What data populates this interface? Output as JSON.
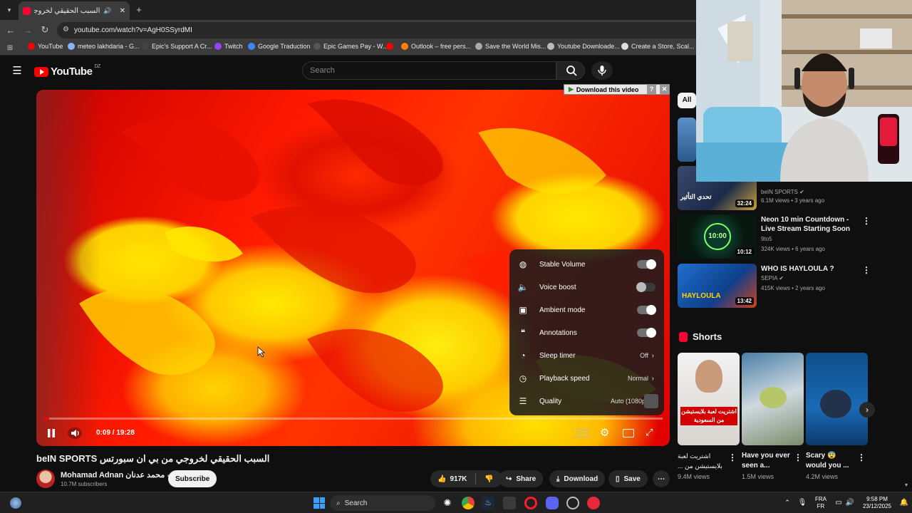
{
  "browser": {
    "tab_title": "السبب الحقيقي لخروجي من بي ...",
    "url": "youtube.com/watch?v=AgH0SSyrdMI",
    "bookmarks": [
      "YouTube",
      "meteo lakhdaria - G...",
      "Epic's Support A Cr...",
      "Twitch",
      "Google Traduction",
      "Epic Games Pay - W...",
      "",
      "Outlook – free pers...",
      "Save the World Mis...",
      "Youtube Downloade...",
      "Create a Store, Scal..."
    ],
    "bookmark_colors": [
      "#ff0000",
      "#8ab4f8",
      "#444444",
      "#9146ff",
      "#4285f4",
      "#555555",
      "#ff0000",
      "#ff7f00",
      "#aaaaaa",
      "#bbbbbb",
      "#e0e0e0"
    ]
  },
  "youtube": {
    "logo": "YouTube",
    "country": "DZ",
    "search_placeholder": "Search"
  },
  "video": {
    "download_banner": "Download this video",
    "time": "0:09 / 19:28",
    "progress_fraction": 0.008,
    "title": "السبب الحقيقي لخروجي من بي ان سبورتس beIN SPORTS",
    "channel": "Mohamad Adnan محمد عدنان",
    "subscribers": "10.7M subscribers",
    "subscribe_label": "Subscribe",
    "likes": "917K",
    "share_label": "Share",
    "download_label": "Download",
    "save_label": "Save"
  },
  "settings_menu": {
    "items": [
      {
        "label": "Stable Volume",
        "icon": "stable-volume-icon",
        "toggle": true
      },
      {
        "label": "Voice boost",
        "icon": "voice-boost-icon",
        "toggle": false
      },
      {
        "label": "Ambient mode",
        "icon": "ambient-mode-icon",
        "toggle": true
      },
      {
        "label": "Annotations",
        "icon": "annotations-icon",
        "toggle": true
      },
      {
        "label": "Sleep timer",
        "icon": "sleep-timer-icon",
        "value": "Off"
      },
      {
        "label": "Playback speed",
        "icon": "playback-speed-icon",
        "value": "Normal"
      },
      {
        "label": "Quality",
        "icon": "quality-icon",
        "value": "Auto (1080p"
      }
    ]
  },
  "sidebar": {
    "chip_all": "All",
    "recommended": [
      {
        "title": "",
        "channel": "beIN SPORTS",
        "meta": "6.1M views • 3 years ago",
        "duration": "32:24"
      },
      {
        "title": "Neon 10 min Countdown - Live Stream Starting Soon",
        "channel": "9to5",
        "meta": "324K views • 6 years ago",
        "duration": "10:12"
      },
      {
        "title": "WHO IS HAYLOULA ?",
        "channel": "SEPIA",
        "meta": "415K views • 2 years ago",
        "duration": "13:42"
      }
    ],
    "thumb_text_1": "تحدي التأثير",
    "thumb_text_2": "10:00",
    "thumb_text_3": "HAYLOULA",
    "shorts_heading": "Shorts",
    "shorts": [
      {
        "title": "اشتريت لعبة بلايستيشن من ...",
        "views": "9.4M views",
        "overlay": "اشتريت لعبة بلايستيشن من السعودية"
      },
      {
        "title": "Have you ever seen a...",
        "views": "1.5M views"
      },
      {
        "title": "Scary 😨 would you ...",
        "views": "4.2M views"
      }
    ]
  },
  "taskbar": {
    "search_placeholder": "Search",
    "lang_top": "FRA",
    "lang_bottom": "FR",
    "time": "9:58 PM",
    "date": "23/12/2025"
  }
}
